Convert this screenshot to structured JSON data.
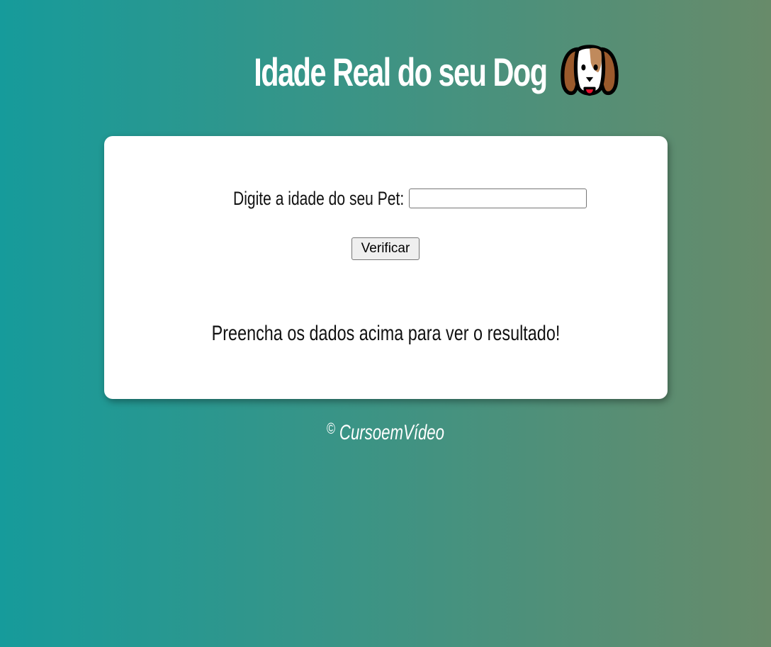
{
  "header": {
    "title": "Idade Real do seu Dog",
    "icon": "dog-face-icon"
  },
  "form": {
    "label": "Digite a idade do seu Pet:",
    "input_value": "",
    "button_label": "Verificar"
  },
  "result": {
    "message": "Preencha os dados acima para ver o resultado!"
  },
  "footer": {
    "symbol": "©",
    "text": "CursoemVídeo"
  },
  "colors": {
    "background_left": "#169b9b",
    "background_right": "#688b6a",
    "card": "#ffffff",
    "dog_brown": "#9b5a2c",
    "dog_tongue": "#e8102e"
  }
}
